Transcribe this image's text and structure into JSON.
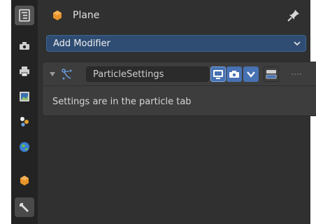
{
  "header": {
    "title": "Plane",
    "object_icon": "object-cube-icon",
    "pin_icon": "pin-icon"
  },
  "sidebar": {
    "items": [
      {
        "name": "tool",
        "icon": "tool-icon",
        "active": true
      },
      {
        "name": "render",
        "icon": "render-icon"
      },
      {
        "name": "output",
        "icon": "output-icon"
      },
      {
        "name": "view-layer",
        "icon": "view-layer-icon"
      },
      {
        "name": "scene",
        "icon": "scene-icon"
      },
      {
        "name": "world",
        "icon": "world-icon"
      },
      {
        "name": "object",
        "icon": "object-icon"
      },
      {
        "name": "modifiers",
        "icon": "wrench-icon",
        "active": true
      }
    ]
  },
  "add_modifier": {
    "label": "Add Modifier"
  },
  "modifier": {
    "name": "ParticleSettings",
    "icon": "particle-system-icon",
    "toggles": [
      "show-in-viewport",
      "show-in-render",
      "show-on-cage",
      "show-in-edit-mode"
    ],
    "message": "Settings are in the particle tab"
  },
  "colors": {
    "accent": "#4772b3",
    "dropdown": "#2f4d73",
    "panel": "#3d3d3d",
    "background": "#303030",
    "sidebar": "#232323"
  }
}
